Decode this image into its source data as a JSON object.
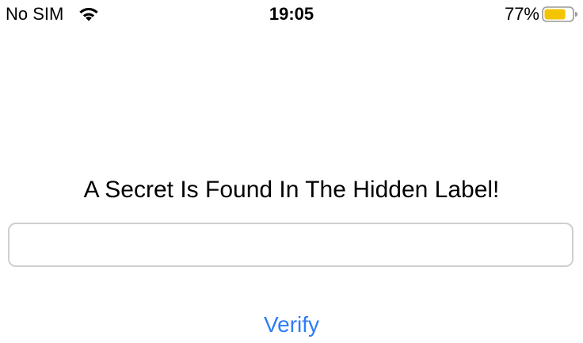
{
  "status_bar": {
    "carrier": "No SIM",
    "time": "19:05",
    "battery_percent": "77%",
    "battery_level": 0.77,
    "battery_color": "#f5c400",
    "wifi_icon": "wifi-icon",
    "battery_icon": "battery-icon"
  },
  "main": {
    "title": "A Secret Is Found In The Hidden Label!",
    "input": {
      "value": "",
      "placeholder": ""
    },
    "verify_label": "Verify"
  },
  "colors": {
    "accent": "#2f7cf6",
    "field_border": "#cfcfcf"
  }
}
